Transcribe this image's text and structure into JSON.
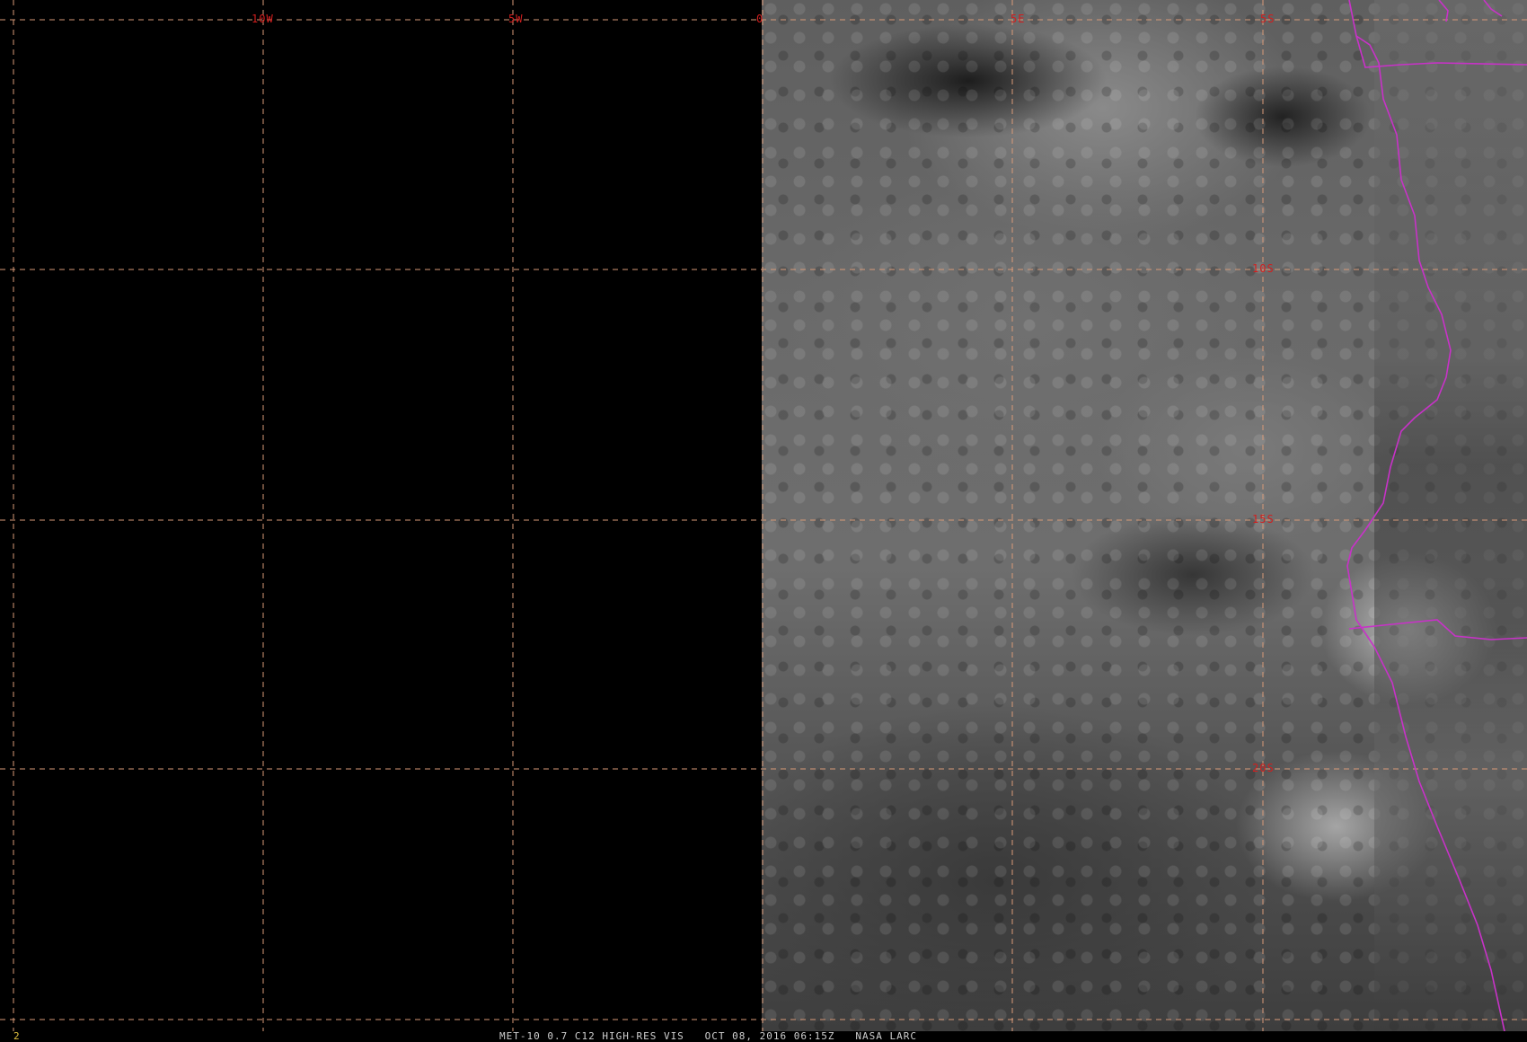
{
  "map": {
    "longitude_labels": [
      "10W",
      "5W",
      "0",
      "5E",
      "5S"
    ],
    "latitude_labels": [
      "10S",
      "15S",
      "20S"
    ],
    "label_color": "#d21e1e",
    "grid_color": "#d89a78",
    "coastline_color": "#c832c8"
  },
  "status_bar": {
    "frame_number": "2",
    "caption": "MET-10 0.7 C12 HIGH-RES VIS   OCT 08, 2016 06:15Z   NASA LARC"
  }
}
